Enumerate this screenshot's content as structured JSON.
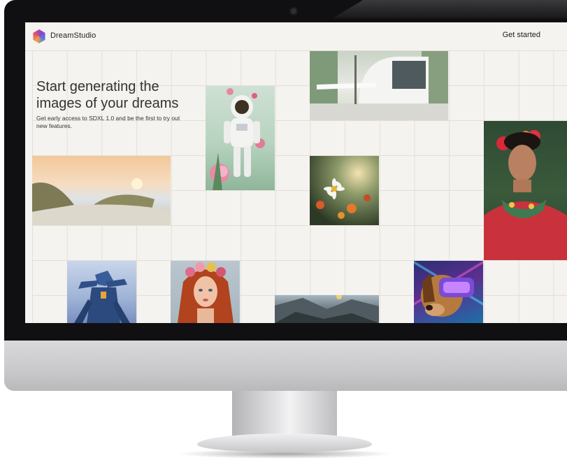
{
  "screen": {
    "topbar": {
      "brand": "DreamStudio",
      "cta_label": "Get started"
    },
    "hero": {
      "title": "Start generating the images of your dreams",
      "subtitle": "Get early access to SDXL 1.0 and be the first to try out new features."
    }
  },
  "colors": {
    "page_bg": "#f5f3ef",
    "grid_line": "#e3dfd7",
    "text": "#222222"
  },
  "icons": {
    "logo": "hexagon-gradient-logo-icon"
  }
}
